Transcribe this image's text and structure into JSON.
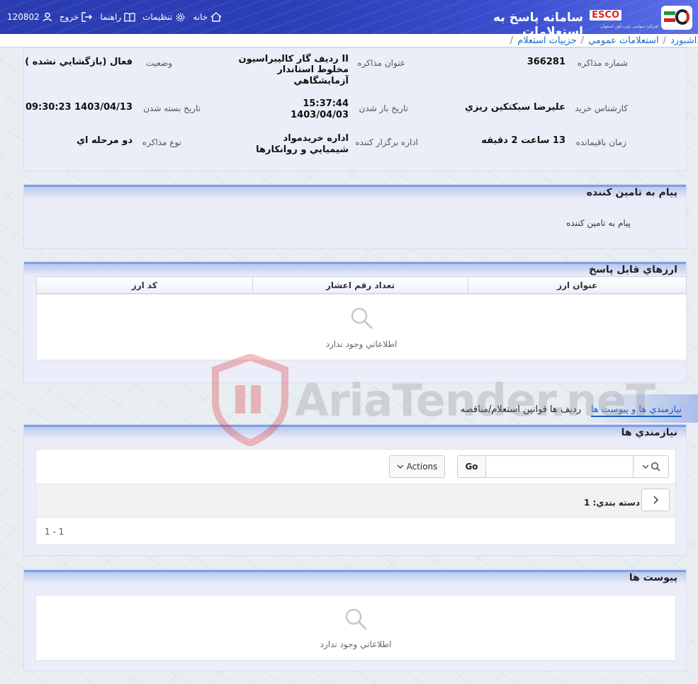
{
  "header": {
    "app_title": "سامانه پاسخ به استعلامات",
    "brand": "ESCO",
    "brand_sub": "شرکت سهامی ذوب آهن اصفهان",
    "nav": {
      "home": "خانه",
      "settings": "تنظیمات",
      "help": "راهنما",
      "logout": "خروج",
      "user_id": "120802"
    }
  },
  "breadcrumb": [
    "داشبورد",
    "استعلامات عمومي",
    "جزييات استعلام"
  ],
  "info": {
    "number_label": "شماره مذاکره",
    "number_value": "366281",
    "subject_label": "عنوان مذاکره",
    "subject_value_1": "II ردیف گار کالیبراسیون",
    "subject_value_2": "مخلوط استاندار",
    "subject_value_3": "آزمايشگاهي",
    "status_label": "وضعیت",
    "status_value": "فعال (بازگشايي نشده )",
    "buyer_label": "کارشناس خريد",
    "buyer_value": "عليرضا سبکتکين ريزي",
    "open_date_label": "تاريخ باز شدن",
    "open_time_value": "15:37:44",
    "open_date_value": "1403/04/03",
    "close_date_label": "تاريخ بسته شدن",
    "close_date_value": "1403/04/13 09:30:23",
    "remaining_label": "زمان باقيمانده",
    "remaining_value": "13 ساعت 2 دقيقه",
    "org_label": "اداره برگزار کننده",
    "org_value_1": "اداره خريدمواد",
    "org_value_2": "شيميايي و روانکارها",
    "type_label": "نوع مذاکره",
    "type_value": "دو مرحله اي"
  },
  "message_panel": {
    "title": "پيام به تامين کننده",
    "text": "پيام به تامين کننده"
  },
  "currency_panel": {
    "title": "ارزهاي قابل پاسخ",
    "columns": [
      "کد ارز",
      "تعداد رقم اعشار",
      "عنوان ارز"
    ],
    "empty_text": "اطلاعاتي وجود ندارد"
  },
  "tabs": [
    "نيازمندي ها و پيوست ها",
    "رديف ها",
    "قوانين استعلام/مناقصه"
  ],
  "requirements_panel": {
    "title": "نيازمندي ها",
    "go_label": "Go",
    "actions_label": "Actions",
    "group_label": "دسته بندي: 1",
    "pager": "1 - 1"
  },
  "attachments_panel": {
    "title": "پيوست ها",
    "empty_text": "اطلاعاتي وجود ندارد"
  },
  "watermark": "AriaTender.neT",
  "colors": {
    "topbar": "#2d3fb8",
    "panel_bg": "#ebedf9",
    "panel_header": "#7f9ee3",
    "link": "#1a6fc2"
  }
}
